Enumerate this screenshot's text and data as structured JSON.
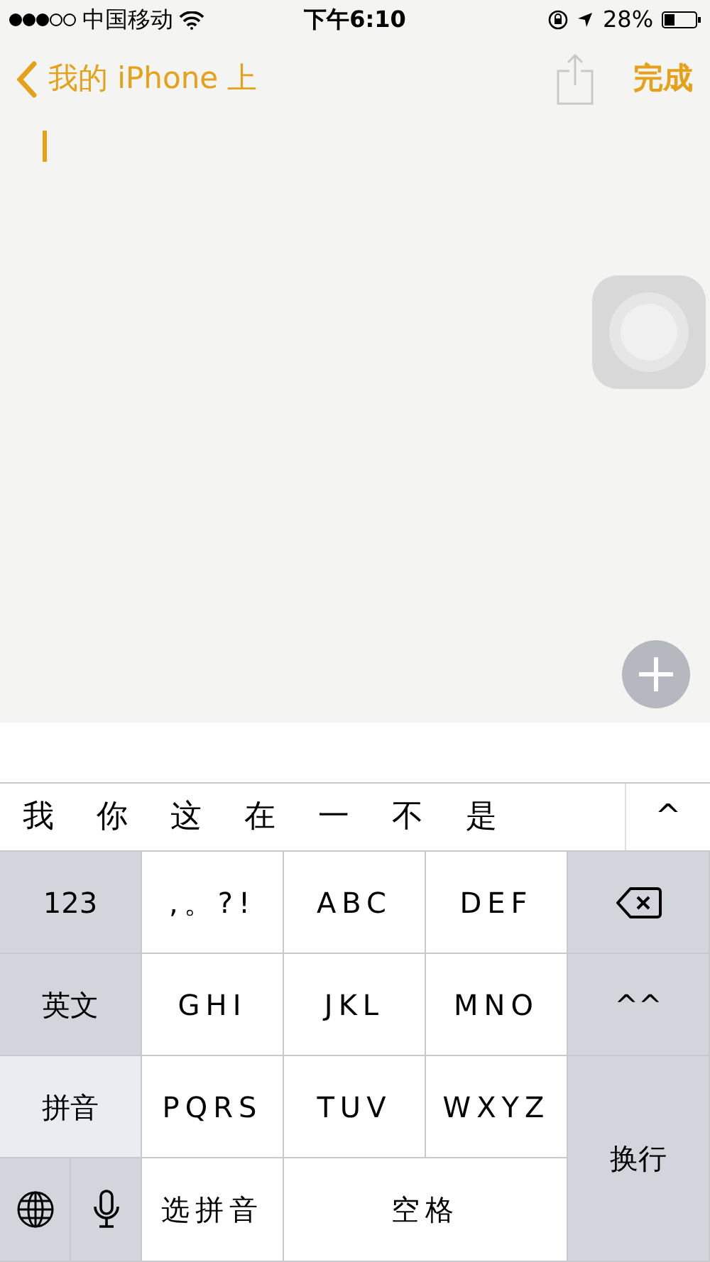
{
  "status_bar": {
    "carrier": "中国移动",
    "time": "下午6:10",
    "battery": "28%"
  },
  "nav": {
    "back": "我的 iPhone 上",
    "done": "完成"
  },
  "candidates": {
    "items": [
      "我",
      "你",
      "这",
      "在",
      "一",
      "不",
      "是"
    ],
    "expand": "^"
  },
  "keys": [
    {
      "kind": "function",
      "label": "123",
      "selected": false
    },
    {
      "kind": "letter",
      "label": ",。?!"
    },
    {
      "kind": "letter",
      "label": "ABC"
    },
    {
      "kind": "letter",
      "label": "DEF"
    },
    {
      "kind": "delete"
    },
    {
      "kind": "function",
      "label": "英文",
      "selected": false
    },
    {
      "kind": "letter",
      "label": "GHI"
    },
    {
      "kind": "letter",
      "label": "JKL"
    },
    {
      "kind": "letter",
      "label": "MNO"
    },
    {
      "kind": "function",
      "label": "^^"
    },
    {
      "kind": "function",
      "label": "拼音",
      "selected": true
    },
    {
      "kind": "letter",
      "label": "PQRS"
    },
    {
      "kind": "letter",
      "label": "TUV"
    },
    {
      "kind": "letter",
      "label": "WXYZ"
    },
    {
      "kind": "return",
      "label": "换行"
    },
    {
      "kind": "globe"
    },
    {
      "kind": "mic"
    },
    {
      "kind": "letter",
      "label": "选拼音"
    },
    {
      "kind": "space",
      "label": "空格"
    }
  ]
}
